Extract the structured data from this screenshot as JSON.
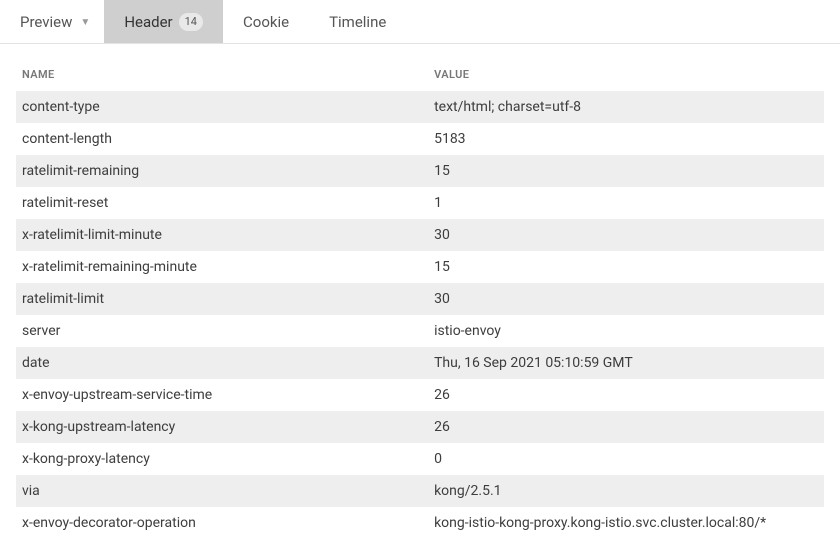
{
  "tabs": {
    "preview": {
      "label": "Preview"
    },
    "header": {
      "label": "Header",
      "badge": "14"
    },
    "cookie": {
      "label": "Cookie"
    },
    "timeline": {
      "label": "Timeline"
    }
  },
  "columns": {
    "name": "NAME",
    "value": "VALUE"
  },
  "headers": [
    {
      "name": "content-type",
      "value": "text/html; charset=utf-8"
    },
    {
      "name": "content-length",
      "value": "5183"
    },
    {
      "name": "ratelimit-remaining",
      "value": "15"
    },
    {
      "name": "ratelimit-reset",
      "value": "1"
    },
    {
      "name": "x-ratelimit-limit-minute",
      "value": "30"
    },
    {
      "name": "x-ratelimit-remaining-minute",
      "value": "15"
    },
    {
      "name": "ratelimit-limit",
      "value": "30"
    },
    {
      "name": "server",
      "value": "istio-envoy"
    },
    {
      "name": "date",
      "value": "Thu, 16 Sep 2021 05:10:59 GMT"
    },
    {
      "name": "x-envoy-upstream-service-time",
      "value": "26"
    },
    {
      "name": "x-kong-upstream-latency",
      "value": "26"
    },
    {
      "name": "x-kong-proxy-latency",
      "value": "0"
    },
    {
      "name": "via",
      "value": "kong/2.5.1"
    },
    {
      "name": "x-envoy-decorator-operation",
      "value": "kong-istio-kong-proxy.kong-istio.svc.cluster.local:80/*"
    }
  ]
}
